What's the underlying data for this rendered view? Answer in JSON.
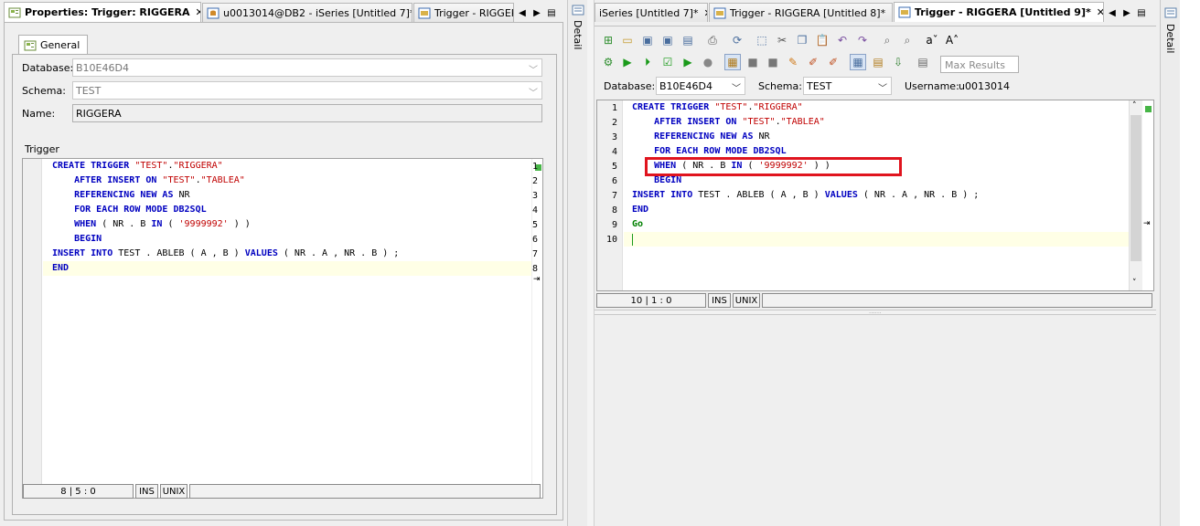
{
  "left_tabs": [
    {
      "label": "Properties: Trigger: RIGGERA",
      "active": true,
      "close": "✕"
    },
    {
      "label": "u0013014@DB2 - iSeries [Untitled 7]*",
      "active": false,
      "close": ""
    },
    {
      "label": "Trigger - RIGGERA",
      "active": false,
      "close": ""
    }
  ],
  "right_tabs": [
    {
      "label": "iSeries [Untitled 7]*",
      "active": false,
      "close": "✕"
    },
    {
      "label": "Trigger - RIGGERA [Untitled 8]*",
      "active": false,
      "close": "✕"
    },
    {
      "label": "Trigger - RIGGERA [Untitled 9]*",
      "active": true,
      "close": "✕"
    }
  ],
  "nav": {
    "prev": "◀",
    "next": "▶",
    "menu": "▤"
  },
  "detail_label": "Detail",
  "left": {
    "general_tab": "General",
    "database_label": "Database:",
    "database_value": "B10E46D4",
    "schema_label": "Schema:",
    "schema_value": "TEST",
    "name_label": "Name:",
    "name_value": "RIGGERA",
    "trigger_label": "Trigger",
    "status": {
      "position": "8 | 5 : 0",
      "mode": "INS",
      "eol": "UNIX"
    }
  },
  "right": {
    "database_label": "Database:",
    "database_value": "B10E46D4",
    "schema_label": "Schema:",
    "schema_value": "TEST",
    "username_label": "Username:",
    "username_value": "u0013014",
    "max_results_placeholder": "Max Results",
    "status": {
      "position": "10 | 1 : 0",
      "mode": "INS",
      "eol": "UNIX"
    }
  },
  "colors": {
    "keyword": "#0000c0",
    "string": "#c00000",
    "go": "#008000",
    "highlight_box": "#e0141e",
    "current_line": "#ffffe6"
  }
}
